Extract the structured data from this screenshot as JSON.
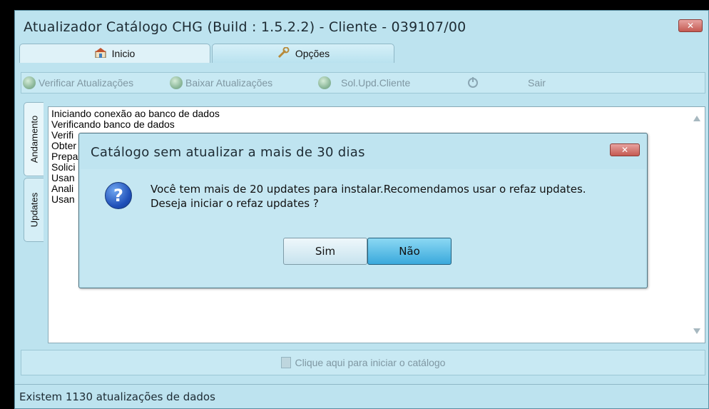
{
  "window": {
    "title": "Atualizador Catálogo CHG  (Build : 1.5.2.2) - Cliente - 039107/00",
    "close_label": "✕"
  },
  "tabs": [
    {
      "label": "Inicio",
      "icon": "house-icon"
    },
    {
      "label": "Opções",
      "icon": "wrench-icon"
    }
  ],
  "toolbar": {
    "verificar": "Verificar Atualizações",
    "baixar": "Baixar Atualizações",
    "solupd": "Sol.Upd.Cliente",
    "sair": "Sair"
  },
  "side_tabs": {
    "andamento": "Andamento",
    "updates": "Updates"
  },
  "log": {
    "lines": [
      "Iniciando conexão ao banco de dados",
      "Verificando banco de dados",
      "Verifi",
      "Obter",
      "Prepa",
      "Solici",
      "Usan",
      "Anali",
      "Usan"
    ]
  },
  "bottom_bar": {
    "label": "Clique aqui para iniciar o catálogo"
  },
  "status_bar": {
    "text": "Existem 1130 atualizações de dados"
  },
  "dialog": {
    "title": "Catálogo sem atualizar a mais de 30 dias",
    "close_label": "✕",
    "message_line1": "Você tem mais de 20 updates para instalar.Recomendamos usar o refaz updates.",
    "message_line2": "Deseja iniciar o refaz updates ?",
    "sim_first": "S",
    "sim_rest": "im",
    "nao_first": "N",
    "nao_rest": "ão"
  },
  "colors": {
    "window_bg": "#bde3ef",
    "accent_button": "#3aa9dc",
    "close_red": "#c45a52"
  }
}
